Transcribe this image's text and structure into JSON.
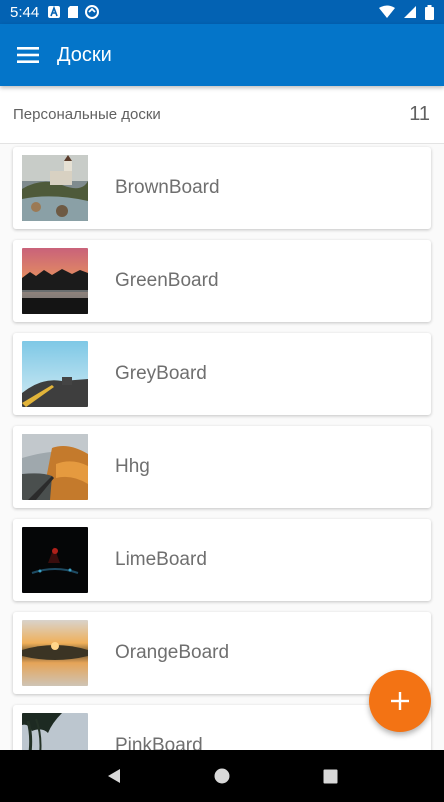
{
  "status": {
    "time": "5:44"
  },
  "appbar": {
    "title": "Доски",
    "menu_icon": "hamburger-menu-icon"
  },
  "section": {
    "title": "Персональные доски",
    "count": "11"
  },
  "boards": [
    {
      "name": "BrownBoard",
      "thumb": "landscape-church"
    },
    {
      "name": "GreenBoard",
      "thumb": "sunset-lake"
    },
    {
      "name": "GreyBoard",
      "thumb": "road-sky"
    },
    {
      "name": "Hhg",
      "thumb": "mountain-road"
    },
    {
      "name": "LimeBoard",
      "thumb": "dark-night"
    },
    {
      "name": "OrangeBoard",
      "thumb": "sunset-reflection"
    },
    {
      "name": "PinkBoard",
      "thumb": "tree-silhouette"
    }
  ],
  "fab": {
    "icon": "plus-icon",
    "color": "#f37314"
  },
  "colors": {
    "appbar": "#0475c9",
    "statusbar": "#0362b3",
    "accent": "#f37314"
  }
}
